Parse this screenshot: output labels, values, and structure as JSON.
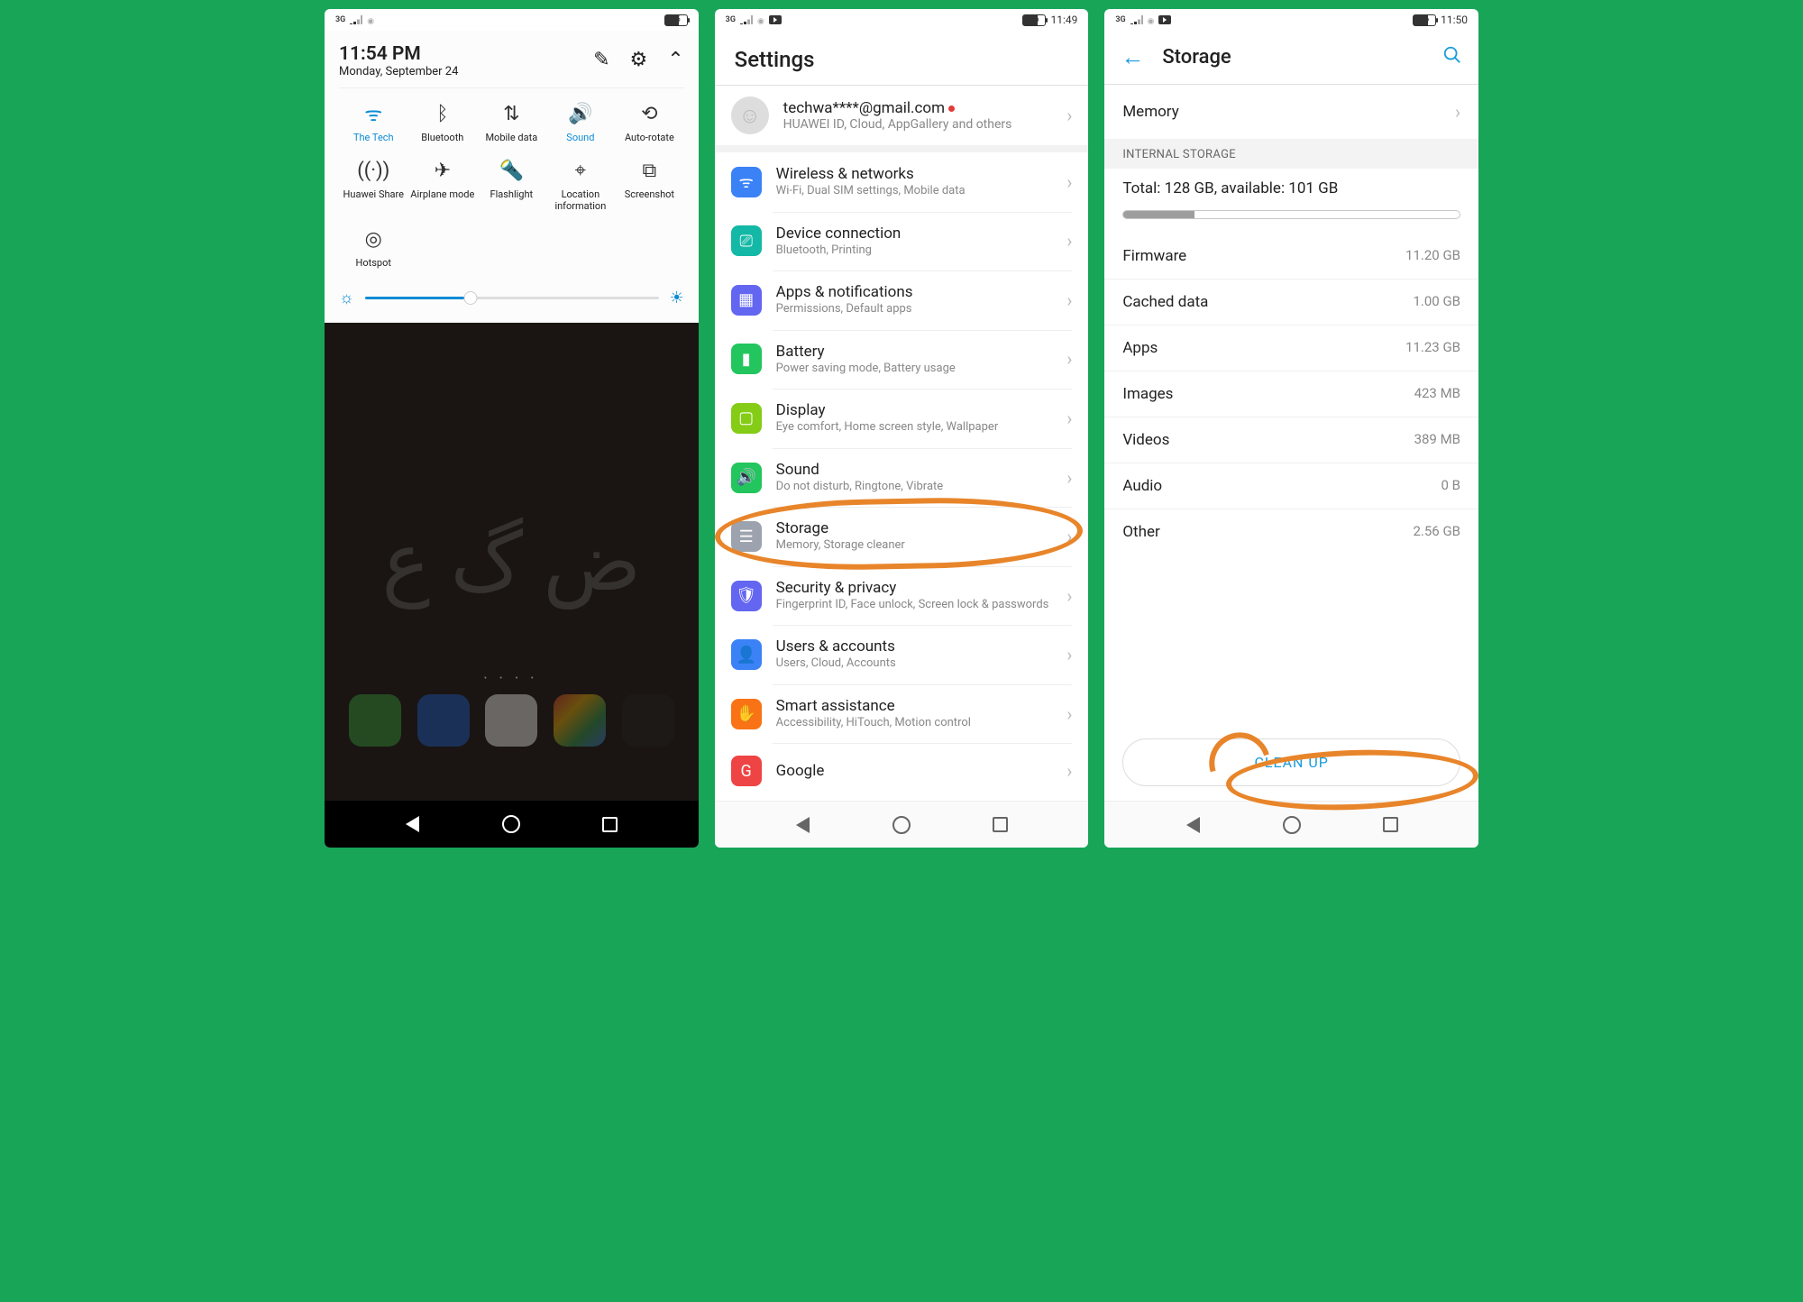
{
  "phone1": {
    "status": {
      "net": "3G",
      "battery_pct": 65
    },
    "time": "11:54 PM",
    "date": "Monday, September 24",
    "tiles": [
      {
        "icon": "wifi-icon",
        "glyph": "ᯤ",
        "label": "The Tech",
        "active": true
      },
      {
        "icon": "bluetooth-icon",
        "glyph": "ᛒ",
        "label": "Bluetooth",
        "active": false
      },
      {
        "icon": "mobiledata-icon",
        "glyph": "⇅",
        "label": "Mobile data",
        "active": false
      },
      {
        "icon": "sound-icon",
        "glyph": "🔊",
        "label": "Sound",
        "active": true
      },
      {
        "icon": "autorotate-icon",
        "glyph": "⟲",
        "label": "Auto-rotate",
        "active": false
      },
      {
        "icon": "huaweishare-icon",
        "glyph": "((·))",
        "label": "Huawei Share",
        "active": false
      },
      {
        "icon": "airplane-icon",
        "glyph": "✈",
        "label": "Airplane mode",
        "active": false
      },
      {
        "icon": "flashlight-icon",
        "glyph": "🔦",
        "label": "Flashlight",
        "active": false
      },
      {
        "icon": "location-icon",
        "glyph": "⌖",
        "label": "Location information",
        "active": false
      },
      {
        "icon": "screenshot-icon",
        "glyph": "⧉",
        "label": "Screenshot",
        "active": false
      },
      {
        "icon": "hotspot-icon",
        "glyph": "◎",
        "label": "Hotspot",
        "active": false
      }
    ]
  },
  "phone2": {
    "status": {
      "net": "3G",
      "battery_pct": 66,
      "time": "11:49"
    },
    "title": "Settings",
    "account": {
      "email": "techwa****@gmail.com",
      "sub": "HUAWEI ID, Cloud, AppGallery and others"
    },
    "items": [
      {
        "color": "c-blue",
        "glyph": "ᯤ",
        "title": "Wireless & networks",
        "sub": "Wi-Fi, Dual SIM settings, Mobile data"
      },
      {
        "color": "c-teal",
        "glyph": "⎚",
        "title": "Device connection",
        "sub": "Bluetooth, Printing"
      },
      {
        "color": "c-indigo",
        "glyph": "▦",
        "title": "Apps & notifications",
        "sub": "Permissions, Default apps"
      },
      {
        "color": "c-green",
        "glyph": "▮",
        "title": "Battery",
        "sub": "Power saving mode, Battery usage"
      },
      {
        "color": "c-lime",
        "glyph": "▢",
        "title": "Display",
        "sub": "Eye comfort, Home screen style, Wallpaper"
      },
      {
        "color": "c-green",
        "glyph": "🔊",
        "title": "Sound",
        "sub": "Do not disturb, Ringtone, Vibrate"
      },
      {
        "color": "c-grey",
        "glyph": "☰",
        "title": "Storage",
        "sub": "Memory, Storage cleaner"
      },
      {
        "color": "c-indigo",
        "glyph": "🛡",
        "title": "Security & privacy",
        "sub": "Fingerprint ID, Face unlock, Screen lock & passwords"
      },
      {
        "color": "c-blue",
        "glyph": "👤",
        "title": "Users & accounts",
        "sub": "Users, Cloud, Accounts"
      },
      {
        "color": "c-orange",
        "glyph": "✋",
        "title": "Smart assistance",
        "sub": "Accessibility, HiTouch, Motion control"
      },
      {
        "color": "c-red",
        "glyph": "G",
        "title": "Google",
        "sub": ""
      }
    ]
  },
  "phone3": {
    "status": {
      "net": "3G",
      "battery_pct": 66,
      "time": "11:50"
    },
    "title": "Storage",
    "memory_label": "Memory",
    "section": "INTERNAL STORAGE",
    "total": "Total: 128 GB, available: 101 GB",
    "rows": [
      {
        "k": "Firmware",
        "v": "11.20 GB"
      },
      {
        "k": "Cached data",
        "v": "1.00 GB"
      },
      {
        "k": "Apps",
        "v": "11.23 GB"
      },
      {
        "k": "Images",
        "v": "423 MB"
      },
      {
        "k": "Videos",
        "v": "389 MB"
      },
      {
        "k": "Audio",
        "v": "0 B"
      },
      {
        "k": "Other",
        "v": "2.56 GB"
      }
    ],
    "cleanup": "CLEAN UP"
  }
}
